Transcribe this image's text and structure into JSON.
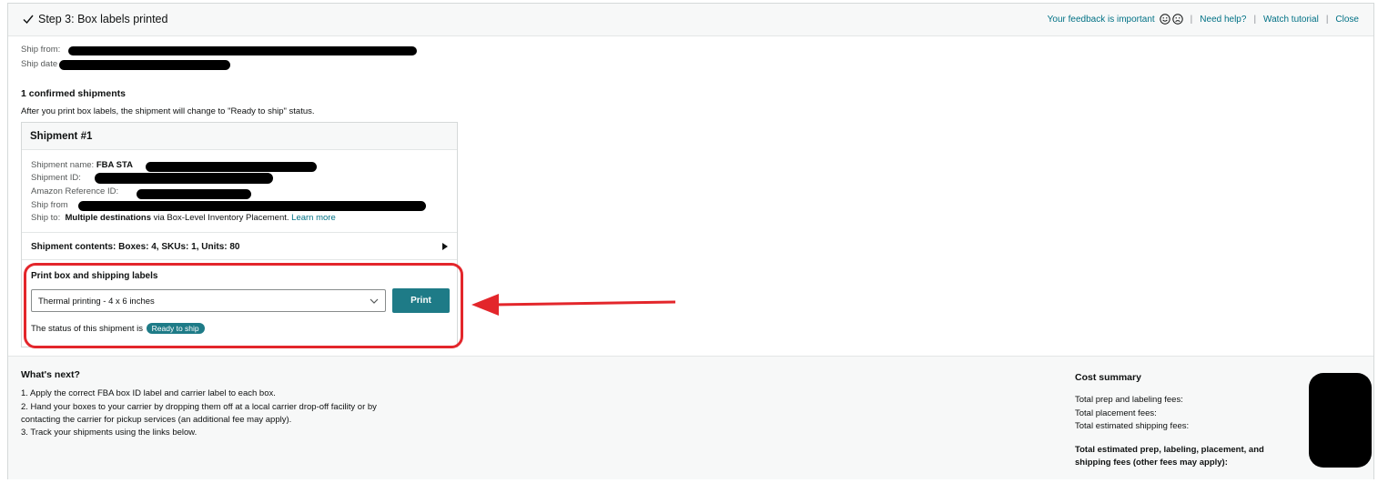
{
  "header": {
    "title": "Step 3: Box labels printed",
    "links": {
      "feedback": "Your feedback is important",
      "help": "Need help?",
      "tutorial": "Watch tutorial",
      "close": "Close"
    }
  },
  "shipment_meta": {
    "ship_from_label": "Ship from:",
    "ship_date_label": "Ship date"
  },
  "confirmed": {
    "title": "1 confirmed shipments",
    "description": "After you print box labels, the shipment will change to \"Ready to ship\" status."
  },
  "shipment": {
    "heading": "Shipment #1",
    "name_label": "Shipment name:",
    "name_value": "FBA STA",
    "id_label": "Shipment ID:",
    "reference_label": "Amazon Reference ID:",
    "ship_from_label": "Ship from",
    "ship_to_label": "Ship to:",
    "ship_to_value": "Multiple destinations",
    "ship_to_suffix": "via Box-Level Inventory Placement.",
    "learn_more": "Learn more",
    "contents": "Shipment contents: Boxes: 4, SKUs: 1, Units: 80"
  },
  "print": {
    "title": "Print box and shipping labels",
    "selected_option": "Thermal printing - 4 x 6 inches",
    "button": "Print",
    "status_text": "The status of this shipment is",
    "status_badge": "Ready to ship"
  },
  "whats_next": {
    "title": "What's next?",
    "steps": [
      "1. Apply the correct FBA box ID label and carrier label to each box.",
      "2. Hand your boxes to your carrier by dropping them off at a local carrier drop-off facility or by",
      "contacting the carrier for pickup services (an additional fee may apply).",
      "3. Track your shipments using the links below."
    ]
  },
  "cost_summary": {
    "title": "Cost summary",
    "items": [
      "Total prep and labeling fees:",
      "Total placement fees:",
      "Total estimated shipping fees:"
    ],
    "total": "Total estimated prep, labeling, placement, and shipping fees (other fees may apply):"
  },
  "colors": {
    "accent": "#1e7b87",
    "link": "#007185",
    "highlight": "#e3262b"
  }
}
